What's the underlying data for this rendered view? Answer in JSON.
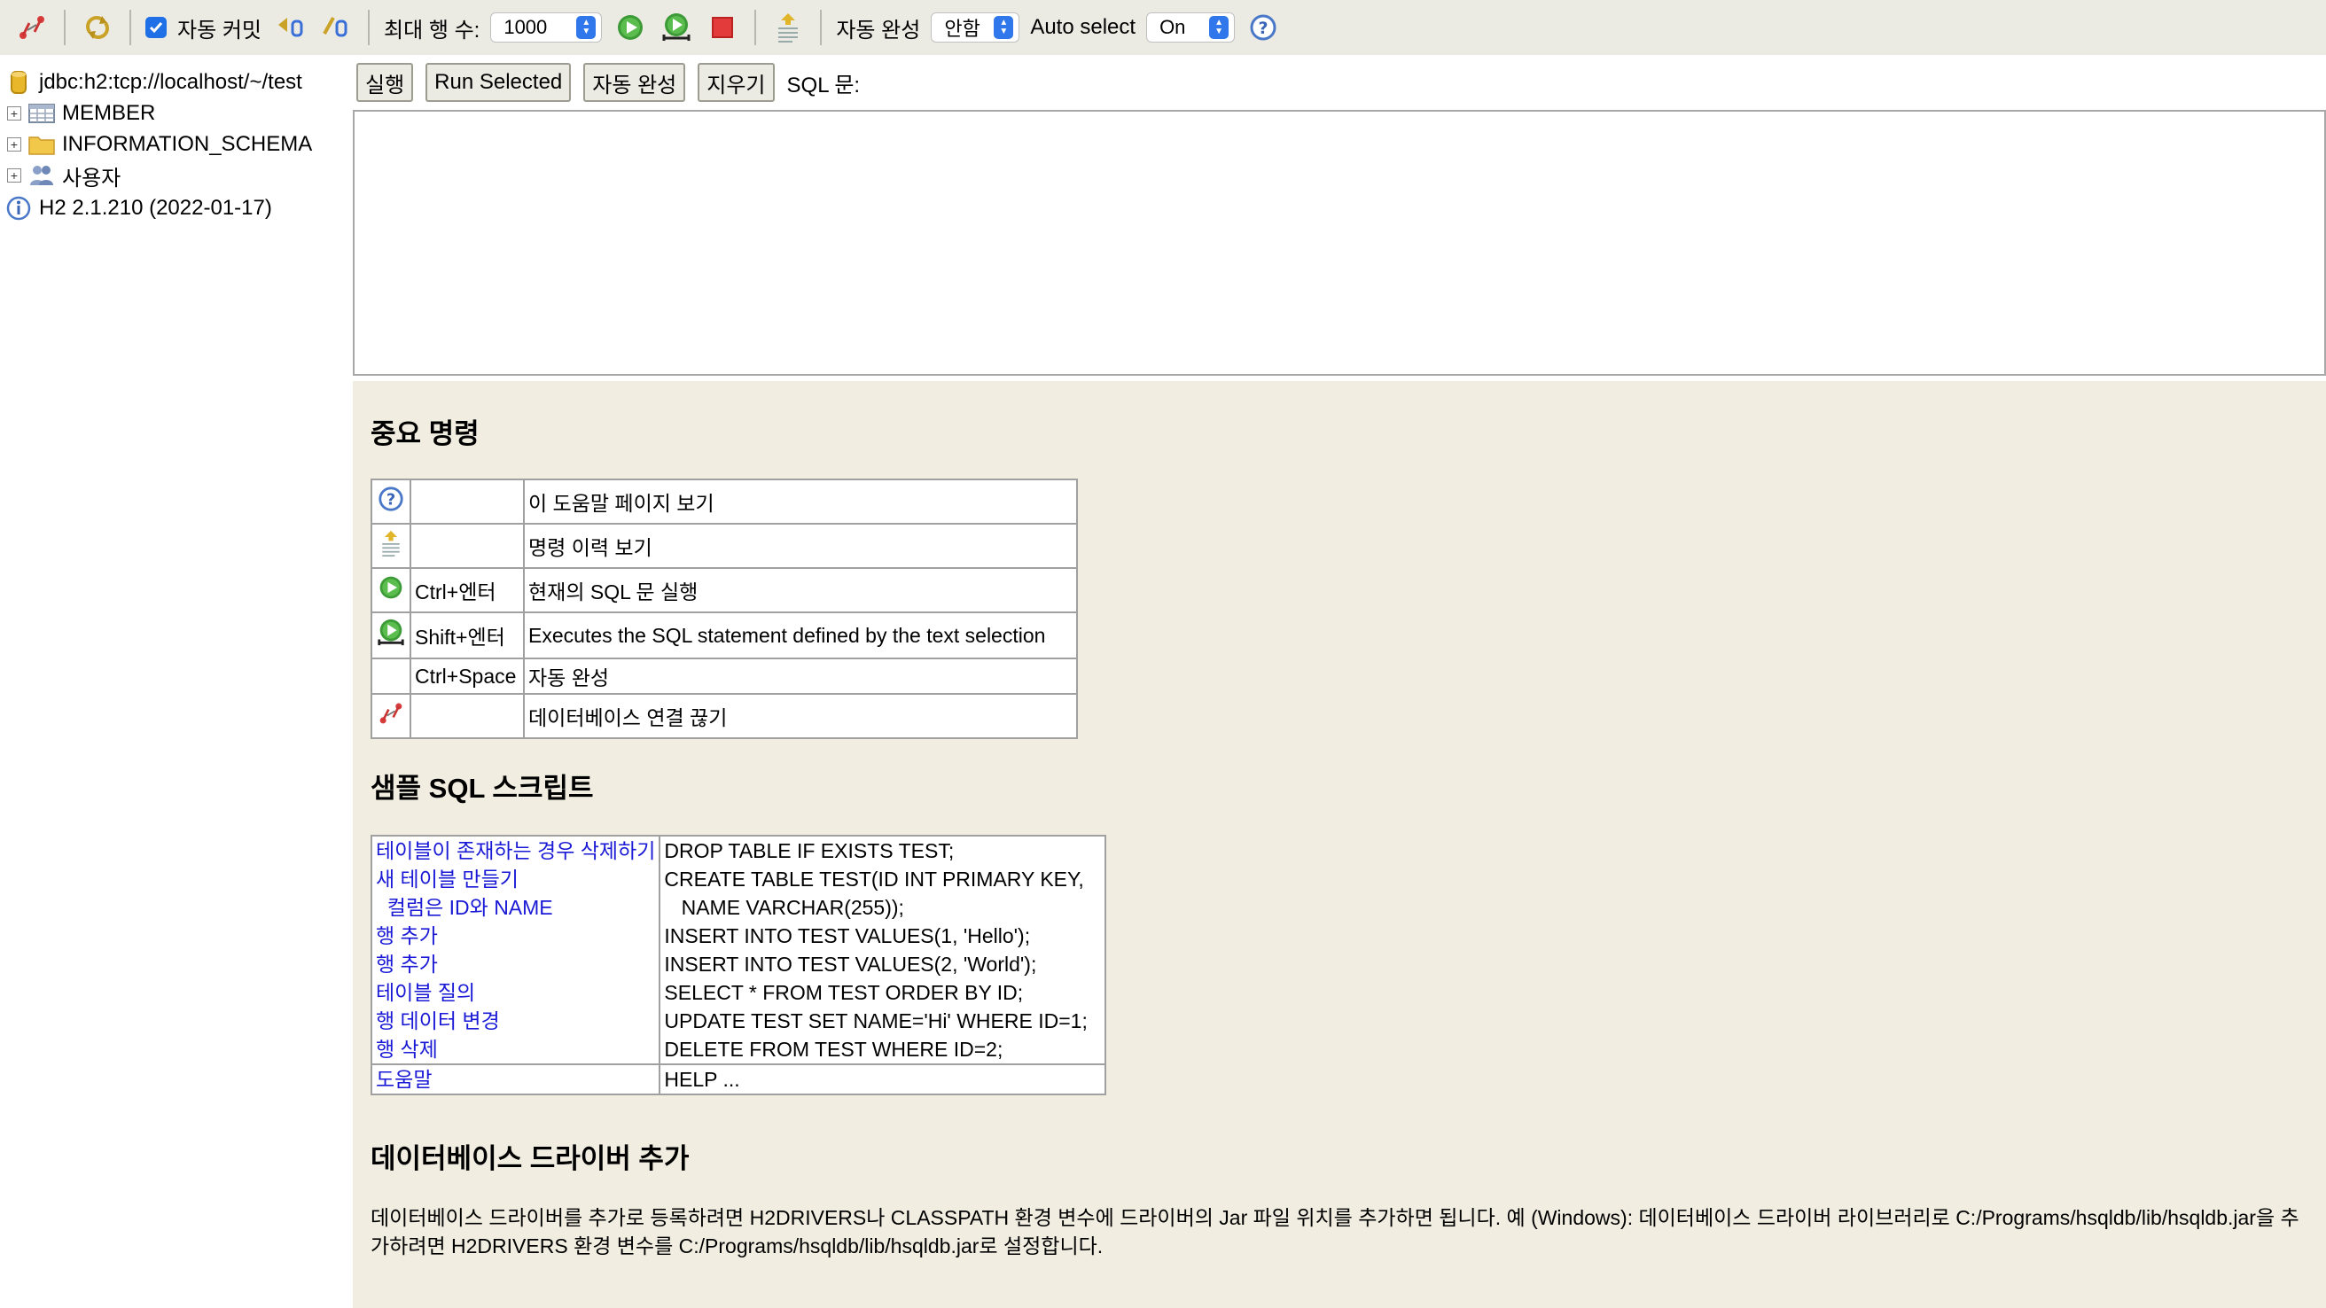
{
  "toolbar": {
    "autocommit_label": "자동 커밋",
    "autocommit_checked": true,
    "max_rows_label": "최대 행 수:",
    "max_rows_value": "1000",
    "autocomplete_label": "자동 완성",
    "autocomplete_value": "안함",
    "autoselect_label": "Auto select",
    "autoselect_value": "On"
  },
  "tree": {
    "connection": "jdbc:h2:tcp://localhost/~/test",
    "items": [
      {
        "label": "MEMBER",
        "icon": "table-icon"
      },
      {
        "label": "INFORMATION_SCHEMA",
        "icon": "folder-icon"
      },
      {
        "label": "사용자",
        "icon": "users-icon"
      }
    ],
    "version": "H2 2.1.210 (2022-01-17)"
  },
  "query": {
    "run_label": "실행",
    "run_selected_label": "Run Selected",
    "autocomplete_label": "자동 완성",
    "clear_label": "지우기",
    "sql_label": "SQL 문:"
  },
  "help": {
    "important_title": "중요 명령",
    "commands": [
      {
        "icon": "help-icon",
        "key": "",
        "desc": "이 도움말 페이지 보기"
      },
      {
        "icon": "history-icon",
        "key": "",
        "desc": "명령 이력 보기"
      },
      {
        "icon": "run-icon",
        "key": "Ctrl+엔터",
        "desc": "현재의 SQL 문 실행"
      },
      {
        "icon": "run-selected-icon",
        "key": "Shift+엔터",
        "desc": "Executes the SQL statement defined by the text selection"
      },
      {
        "icon": "",
        "key": "Ctrl+Space",
        "desc": "자동 완성"
      },
      {
        "icon": "disconnect-icon",
        "key": "",
        "desc": "데이터베이스 연결 끊기"
      }
    ],
    "sample_title": "샘플 SQL 스크립트",
    "sample_rows": [
      {
        "label": "테이블이 존재하는 경우 삭제하기",
        "sql": "DROP TABLE IF EXISTS TEST;"
      },
      {
        "label": "새 테이블 만들기",
        "sql": "CREATE TABLE TEST(ID INT PRIMARY KEY,"
      },
      {
        "label": "  컬럼은 ID와 NAME",
        "sql": "   NAME VARCHAR(255));"
      },
      {
        "label": "행 추가",
        "sql": "INSERT INTO TEST VALUES(1, 'Hello');"
      },
      {
        "label": "행 추가",
        "sql": "INSERT INTO TEST VALUES(2, 'World');"
      },
      {
        "label": "테이블 질의",
        "sql": "SELECT * FROM TEST ORDER BY ID;"
      },
      {
        "label": "행 데이터 변경",
        "sql": "UPDATE TEST SET NAME='Hi' WHERE ID=1;"
      },
      {
        "label": "행 삭제",
        "sql": "DELETE FROM TEST WHERE ID=2;"
      }
    ],
    "help_row": {
      "label": "도움말",
      "sql": "HELP ..."
    },
    "driver_title": "데이터베이스 드라이버 추가",
    "driver_text": "데이터베이스 드라이버를 추가로 등록하려면 H2DRIVERS나 CLASSPATH 환경 변수에 드라이버의 Jar 파일 위치를 추가하면 됩니다. 예 (Windows): 데이터베이스 드라이버 라이브러리로 C:/Programs/hsqldb/lib/hsqldb.jar을 추가하려면 H2DRIVERS 환경 변수를 C:/Programs/hsqldb/lib/hsqldb.jar로 설정합니다."
  }
}
